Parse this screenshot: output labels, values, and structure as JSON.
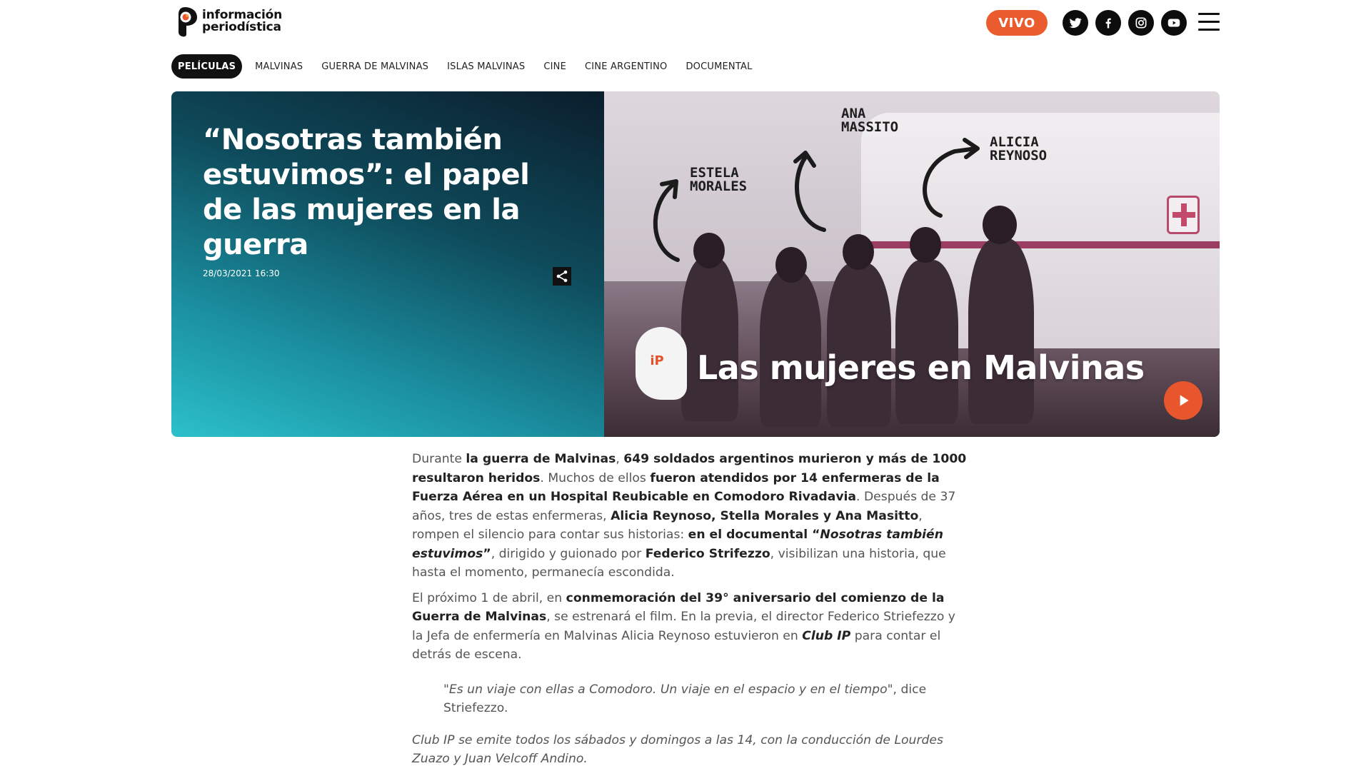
{
  "header": {
    "logo_line1": "información",
    "logo_line2": "periodística",
    "vivo_label": "VIVO",
    "social": [
      "twitter-icon",
      "facebook-icon",
      "instagram-icon",
      "youtube-icon"
    ],
    "accent": "#ea5b2e"
  },
  "tags": [
    "PELÍCULAS",
    "MALVINAS",
    "GUERRA DE MALVINAS",
    "ISLAS MALVINAS",
    "CINE",
    "CINE ARGENTINO",
    "DOCUMENTAL"
  ],
  "hero": {
    "title": "“Nosotras también estuvimos”: el papel de las mujeres en la guerra",
    "date": "28/03/2021 16:30",
    "photo_labels": {
      "estela_l1": "ESTELA",
      "estela_l2": "MORALES",
      "ana_l1": "ANA",
      "ana_l2": "MASSITO",
      "alicia_l1": "ALICIA",
      "alicia_l2": "REYNOSO"
    },
    "badge": "iP",
    "overlay_title": "Las mujeres en Malvinas"
  },
  "article": {
    "p1": [
      {
        "t": "Durante ",
        "b": false
      },
      {
        "t": "la guerra de Malvinas",
        "b": true
      },
      {
        "t": ", ",
        "b": false
      },
      {
        "t": "649 soldados argentinos murieron y más de 1000 resultaron heridos",
        "b": true
      },
      {
        "t": ". Muchos de ellos ",
        "b": false
      },
      {
        "t": "fueron atendidos por 14 enfermeras de la Fuerza Aérea en un Hospital Reubicable en Comodoro Rivadavia",
        "b": true
      },
      {
        "t": ". Después de 37 años, tres de estas enfermeras, ",
        "b": false
      },
      {
        "t": "Alicia Reynoso, Stella Morales y Ana Masitto",
        "b": true
      },
      {
        "t": ", rompen el silencio para contar sus historias: ",
        "b": false
      },
      {
        "t": "en el documental “",
        "b": true
      },
      {
        "t": "Nosotras también estuvimos",
        "b": true,
        "i": true
      },
      {
        "t": "”",
        "b": true
      },
      {
        "t": ", dirigido y guionado por ",
        "b": false
      },
      {
        "t": "Federico Strifezzo",
        "b": true
      },
      {
        "t": ", visibilizan una historia, que hasta el momento, permanecía escondida.",
        "b": false
      }
    ],
    "p2": [
      {
        "t": "El próximo 1 de abril, en ",
        "b": false
      },
      {
        "t": "conmemoración del 39° aniversario del comienzo de la Guerra de Malvinas",
        "b": true
      },
      {
        "t": ", se estrenará el film. En la previa, el director Federico Striefezzo y la Jefa de enfermería en Malvinas Alicia Reynoso estuvieron en ",
        "b": false
      },
      {
        "t": "Club IP",
        "b": true,
        "i": true
      },
      {
        "t": " para contar el detrás de escena.",
        "b": false
      }
    ],
    "quote_text": "\"Es un viaje con ellas a Comodoro. Un viaje en el espacio y en el tiempo\"",
    "quote_tail": ", dice Striefezzo.",
    "outro": "Club IP se emite todos los sábados y domingos a las 14, con la conducción de Lourdes Zuazo y Juan Velcoff Andino."
  }
}
